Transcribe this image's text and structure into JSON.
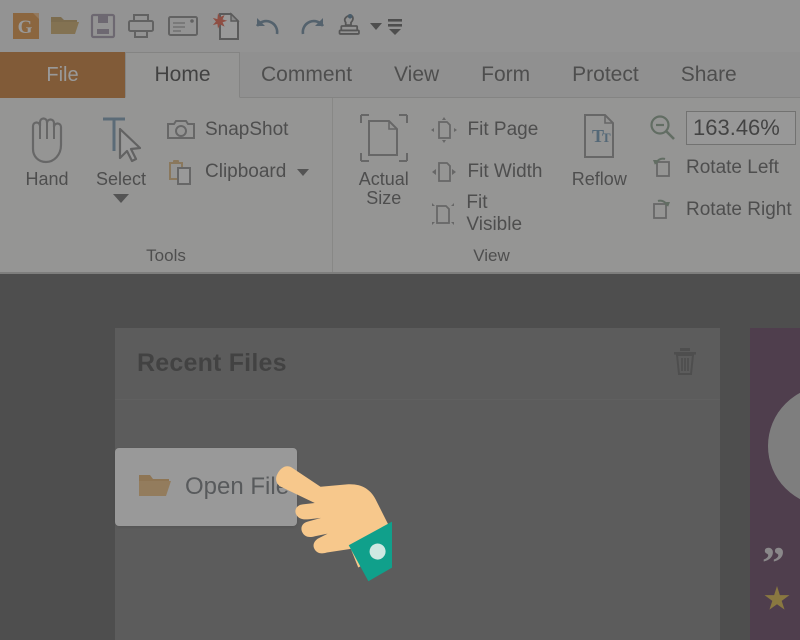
{
  "app": {
    "zoom_level": "163.46%"
  },
  "quick_access_toolbar": {
    "items": [
      {
        "name": "app-logo-icon",
        "label": "Gaaiho PDF"
      },
      {
        "name": "open-icon",
        "label": "Open"
      },
      {
        "name": "save-icon",
        "label": "Save"
      },
      {
        "name": "print-icon",
        "label": "Print"
      },
      {
        "name": "email-icon",
        "label": "Email"
      },
      {
        "name": "create-pdf-icon",
        "label": "Create PDF"
      },
      {
        "name": "undo-icon",
        "label": "Undo"
      },
      {
        "name": "redo-icon",
        "label": "Redo"
      },
      {
        "name": "stamp-icon",
        "label": "Stamp"
      },
      {
        "name": "customize-toolbar-icon",
        "label": "Customize Quick Access Toolbar"
      }
    ]
  },
  "tabs": [
    {
      "label": "File",
      "active": false,
      "kind": "file"
    },
    {
      "label": "Home",
      "active": true,
      "kind": "normal"
    },
    {
      "label": "Comment",
      "active": false,
      "kind": "normal"
    },
    {
      "label": "View",
      "active": false,
      "kind": "normal"
    },
    {
      "label": "Form",
      "active": false,
      "kind": "normal"
    },
    {
      "label": "Protect",
      "active": false,
      "kind": "normal"
    },
    {
      "label": "Share",
      "active": false,
      "kind": "normal"
    }
  ],
  "ribbon": {
    "groups": [
      {
        "title": "Tools",
        "big_buttons": [
          {
            "label": "Hand",
            "icon": "hand-icon",
            "has_dropdown": false
          },
          {
            "label": "Select",
            "icon": "select-text-icon",
            "has_dropdown": true
          }
        ],
        "small_buttons": [
          {
            "label": "SnapShot",
            "icon": "camera-icon",
            "has_dropdown": false
          },
          {
            "label": "Clipboard",
            "icon": "clipboard-icon",
            "has_dropdown": true
          }
        ]
      },
      {
        "title": "View",
        "big_buttons": [
          {
            "label": "Actual\nSize",
            "icon": "actual-size-icon",
            "has_dropdown": false
          },
          {
            "label": "Reflow",
            "icon": "reflow-icon",
            "has_dropdown": false
          }
        ],
        "small_buttons": [
          {
            "label": "Fit Page",
            "icon": "fit-page-icon",
            "has_dropdown": false
          },
          {
            "label": "Fit Width",
            "icon": "fit-width-icon",
            "has_dropdown": false
          },
          {
            "label": "Fit Visible",
            "icon": "fit-visible-icon",
            "has_dropdown": false
          },
          {
            "label": "Rotate Left",
            "icon": "rotate-left-icon",
            "has_dropdown": false
          },
          {
            "label": "Rotate Right",
            "icon": "rotate-right-icon",
            "has_dropdown": false
          }
        ]
      }
    ]
  },
  "recent_files": {
    "title": "Recent Files",
    "clear_label": "Clear recent files",
    "open_file_label": "Open File"
  },
  "colors": {
    "file_tab": "#c05c00",
    "ribbon_bg": "#f4f4f2",
    "workspace_bg": "#3c3c3c",
    "panel_bg": "#606060",
    "folder_orange": "#eeab4c",
    "promo_purple": "#3d1139",
    "cursor_skin": "#f7c88c",
    "cursor_cuff": "#10a08b",
    "star_yellow": "#d6a816"
  }
}
